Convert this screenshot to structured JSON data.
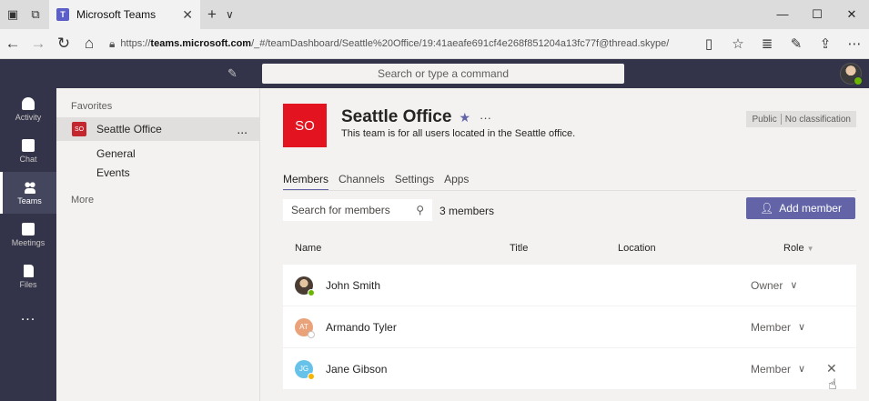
{
  "browser": {
    "tab_title": "Microsoft Teams",
    "tab_icon_text": "T",
    "url_prefix": "https://",
    "url_host": "teams.microsoft.com",
    "url_path": "/_#/teamDashboard/Seattle%20Office/19:41aeafe691cf4e268f851204a13fc77f@thread.skype/"
  },
  "teams_bar": {
    "search_placeholder": "Search or type a command"
  },
  "rail": {
    "items": [
      {
        "label": "Activity",
        "icon": "bell-icon"
      },
      {
        "label": "Chat",
        "icon": "chat-icon"
      },
      {
        "label": "Teams",
        "icon": "teams-icon"
      },
      {
        "label": "Meetings",
        "icon": "calendar-icon"
      },
      {
        "label": "Files",
        "icon": "file-icon"
      }
    ],
    "more": "..."
  },
  "panel": {
    "favorites_label": "Favorites",
    "team_name": "Seattle Office",
    "team_avatar_text": "SO",
    "team_more": "...",
    "channels": [
      "General",
      "Events"
    ],
    "more_label": "More"
  },
  "team": {
    "initials": "SO",
    "title": "Seattle Office",
    "description": "This team is for all users located in the Seattle office.",
    "badge_privacy": "Public",
    "badge_classification": "No classification",
    "more": "···"
  },
  "tabs": [
    "Members",
    "Channels",
    "Settings",
    "Apps"
  ],
  "members_toolbar": {
    "search_placeholder": "Search for members",
    "count": "3 members",
    "add_label": "Add member"
  },
  "columns": {
    "name": "Name",
    "title": "Title",
    "location": "Location",
    "role": "Role"
  },
  "members": [
    {
      "name": "John Smith",
      "initials": "",
      "role": "Owner",
      "avatar_color": "#5b4a3f",
      "presence_color": "#6bb700"
    },
    {
      "name": "Armando Tyler",
      "initials": "AT",
      "role": "Member",
      "avatar_color": "#e9a27a",
      "presence_color": "#ffffff"
    },
    {
      "name": "Jane Gibson",
      "initials": "JG",
      "role": "Member",
      "avatar_color": "#66c2e8",
      "presence_color": "#f8b500"
    }
  ],
  "colors": {
    "accent": "#6264a7",
    "team_tile": "#e3131f",
    "rail_bg": "#33344a"
  }
}
